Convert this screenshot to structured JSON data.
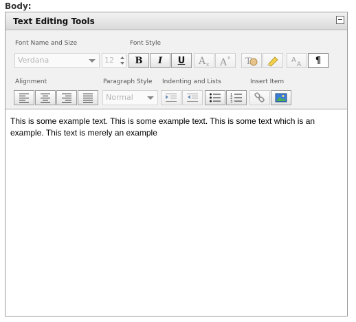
{
  "field": {
    "label": "Body:"
  },
  "editor": {
    "title": "Text Editing Tools"
  },
  "toolbar": {
    "font_name_size_label": "Font Name and Size",
    "font_style_label": "Font Style",
    "font_name_value": "Verdana",
    "font_size_value": "12",
    "bold_glyph": "B",
    "italic_glyph": "I",
    "underline_glyph": "U",
    "alignment_label": "Alignment",
    "paragraph_style_label": "Paragraph Style",
    "paragraph_style_value": "Normal",
    "indent_lists_label": "Indenting and Lists",
    "insert_item_label": "Insert Item",
    "pilcrow_glyph": "¶"
  },
  "content": {
    "text": "This is some example text. This is some example text. This is some text which is an example. This text is merely an example"
  }
}
